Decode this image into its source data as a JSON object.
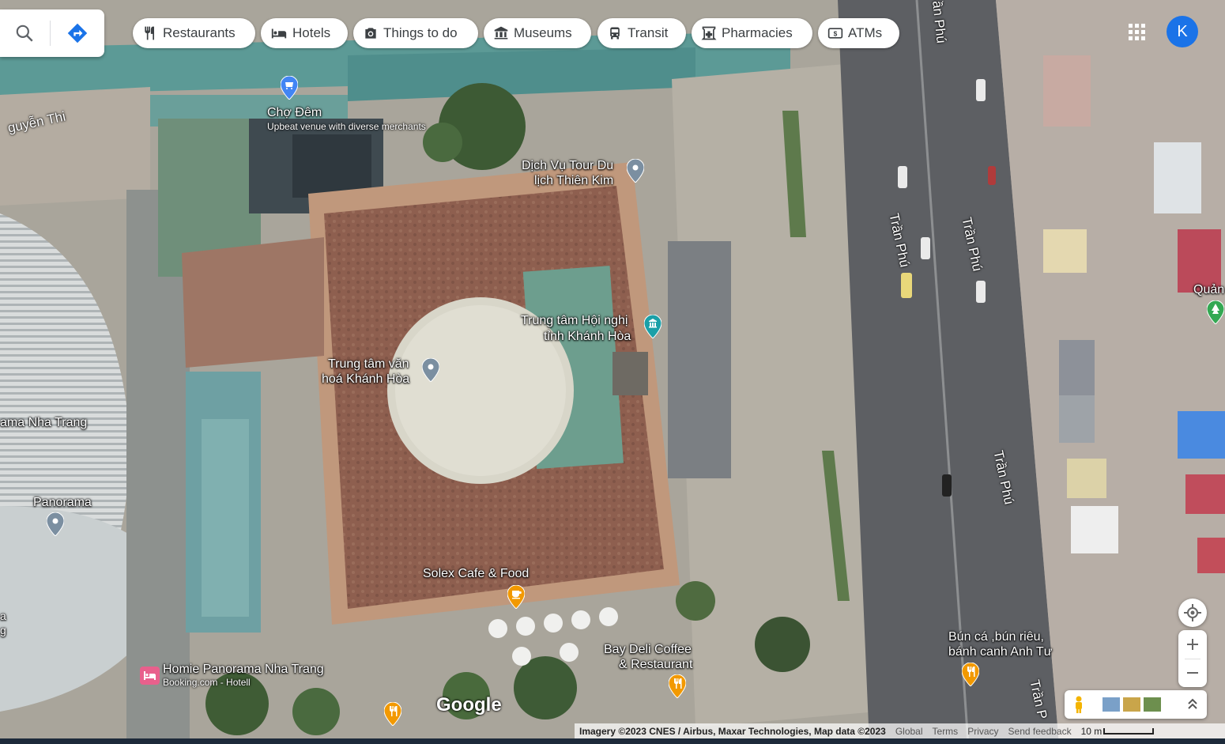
{
  "search": {
    "search_icon": "search-icon",
    "directions_icon": "directions-icon"
  },
  "chips": [
    {
      "label": "Restaurants",
      "icon": "fork-knife-icon"
    },
    {
      "label": "Hotels",
      "icon": "bed-icon"
    },
    {
      "label": "Things to do",
      "icon": "camera-icon"
    },
    {
      "label": "Museums",
      "icon": "museum-icon"
    },
    {
      "label": "Transit",
      "icon": "bus-icon"
    },
    {
      "label": "Pharmacies",
      "icon": "pharmacy-icon"
    },
    {
      "label": "ATMs",
      "icon": "atm-icon"
    }
  ],
  "account": {
    "initial": "K",
    "color": "#1a73e8"
  },
  "places": {
    "cho_dem": {
      "name": "Chợ Đêm",
      "desc": "Upbeat venue with diverse merchants"
    },
    "dich_vu_tour": {
      "line1": "Dịch Vụ Tour Du",
      "line2": "lịch Thiên Kim"
    },
    "trung_tam_hoi_nghi": {
      "line1": "Trung tâm Hội nghị",
      "line2": "tỉnh Khánh Hòa"
    },
    "trung_tam_van_hoa": {
      "line1": "Trung tâm văn",
      "line2": "hoá Khánh Hòa"
    },
    "panorama": {
      "name": "Panorama"
    },
    "panorama_nha_trang": {
      "name": "ama Nha Trang"
    },
    "solex": {
      "name": "Solex Cafe & Food"
    },
    "bay_deli": {
      "line1": "Bay Deli Coffee",
      "line2": "& Restaurant"
    },
    "homie": {
      "name": "Homie Panorama Nha Trang",
      "desc": "Booking.com - Hotell"
    },
    "bun_ca": {
      "line1": "Bún cá ,bún riêu,",
      "line2": "bánh canh Anh Tư"
    },
    "quan": {
      "name": "Quản"
    }
  },
  "roads": {
    "nguyen_thi": "guyễn Thi",
    "tran_phu_top": "ần Phú",
    "tran_phu_1": "Trần Phú",
    "tran_phu_2": "Trần Phú",
    "tran_phu_3": "Trần Phú",
    "tran_phu_bottom": "Trần P",
    "edge_a": "a",
    "edge_g": "g"
  },
  "brand": "Google",
  "footer": {
    "imagery": "Imagery ©2023 CNES / Airbus, Maxar Technologies, Map data ©2023",
    "global": "Global",
    "terms": "Terms",
    "privacy": "Privacy",
    "feedback": "Send feedback",
    "scale": "10 m"
  },
  "colors": {
    "chip_text": "#3c4043",
    "pin_restaurant": "#f29900",
    "pin_default": "#7b8fa1",
    "pin_blue": "#4285f4",
    "pin_museum": "#1ba0a8",
    "pin_green": "#34a853",
    "pin_hotel": "#e8608c"
  }
}
